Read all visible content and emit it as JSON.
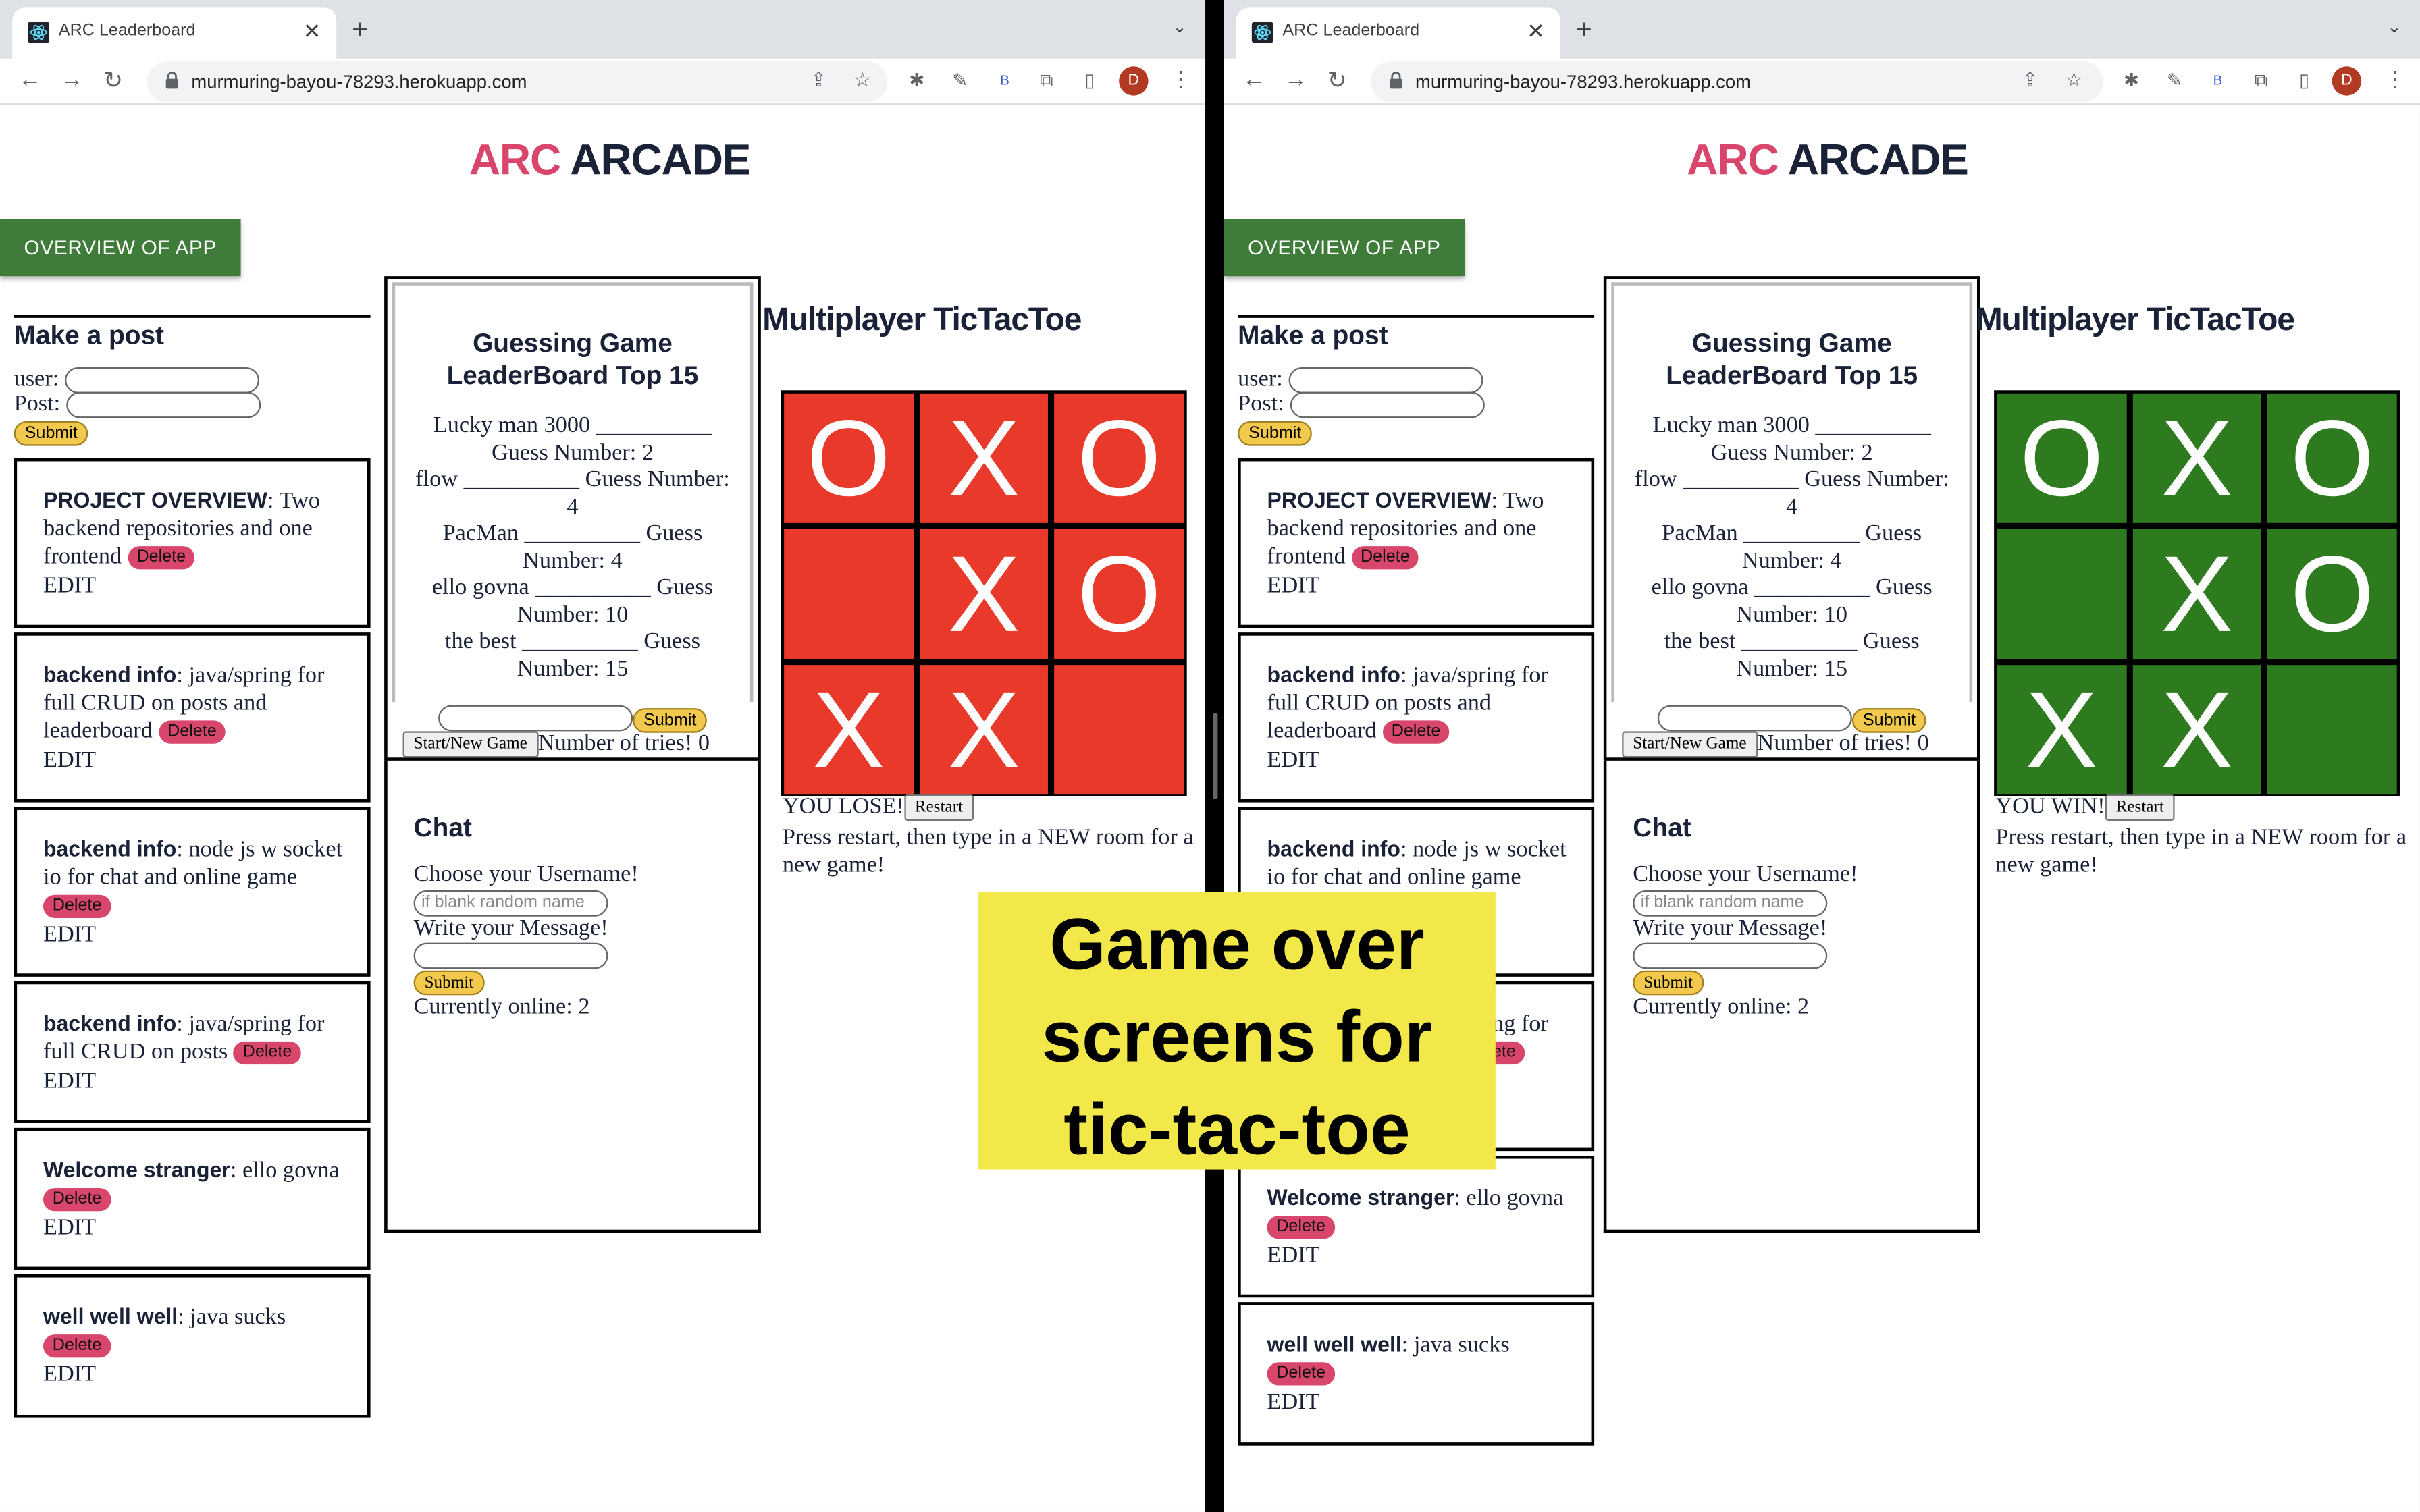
{
  "browser": {
    "tab_title": "ARC Leaderboard",
    "url": "murmuring-bayou-78293.herokuapp.com",
    "avatar_letter": "D",
    "ext_label": "B"
  },
  "page": {
    "brand_part1": "ARC",
    "brand_part2": "ARCADE",
    "overview_button": "OVERVIEW OF APP"
  },
  "make_post": {
    "heading": "Make a post",
    "user_label": "user:",
    "post_label": "Post:",
    "submit_label": "Submit"
  },
  "posts": [
    {
      "title": "PROJECT OVERVIEW",
      "body": ": Two backend repositories and one frontend"
    },
    {
      "title": "backend info",
      "body": ": java/spring for full CRUD on posts and leaderboard"
    },
    {
      "title": "backend info",
      "body": ": node js w socket io for chat and online game"
    },
    {
      "title": "backend info",
      "body": ": java/spring for full CRUD on posts"
    },
    {
      "title": "Welcome stranger",
      "body": ": ello govna"
    },
    {
      "title": "well well well",
      "body": ": java sucks"
    }
  ],
  "post_delete_label": "Delete",
  "post_edit_label": "EDIT",
  "leaderboard": {
    "heading_line1": "Guessing Game",
    "heading_line2": "LeaderBoard Top 15",
    "entries": [
      {
        "name": "Lucky man 3000",
        "text": "Guess Number: 2"
      },
      {
        "name": "flow",
        "text": "Guess Number: 4"
      },
      {
        "name": "PacMan",
        "text": "Guess Number: 4"
      },
      {
        "name": "ello govna",
        "text": "Guess Number: 10"
      },
      {
        "name": "the best",
        "text": "Guess Number: 15"
      }
    ],
    "submit_label": "Submit",
    "start_label": "Start/New Game",
    "tries_text": "Number of tries! 0"
  },
  "chat": {
    "heading": "Chat",
    "username_label": "Choose your Username!",
    "username_placeholder": "if blank random name",
    "message_label": "Write your Message!",
    "submit_label": "Submit",
    "online_text": "Currently online: 2"
  },
  "tictactoe": {
    "title": "Multiplayer TicTacToe",
    "board": [
      "O",
      "X",
      "O",
      "",
      "X",
      "O",
      "X",
      "X",
      ""
    ],
    "left_result": "YOU LOSE!",
    "right_result": "YOU WIN!",
    "restart_label": "Restart",
    "instruction": "Press restart, then type in a NEW room for a new game!",
    "lose_color": "#e8392b",
    "win_color": "#2e7a1e"
  },
  "caption": {
    "line1": "Game over",
    "line2": "screens for",
    "line3": "tic-tac-toe"
  }
}
